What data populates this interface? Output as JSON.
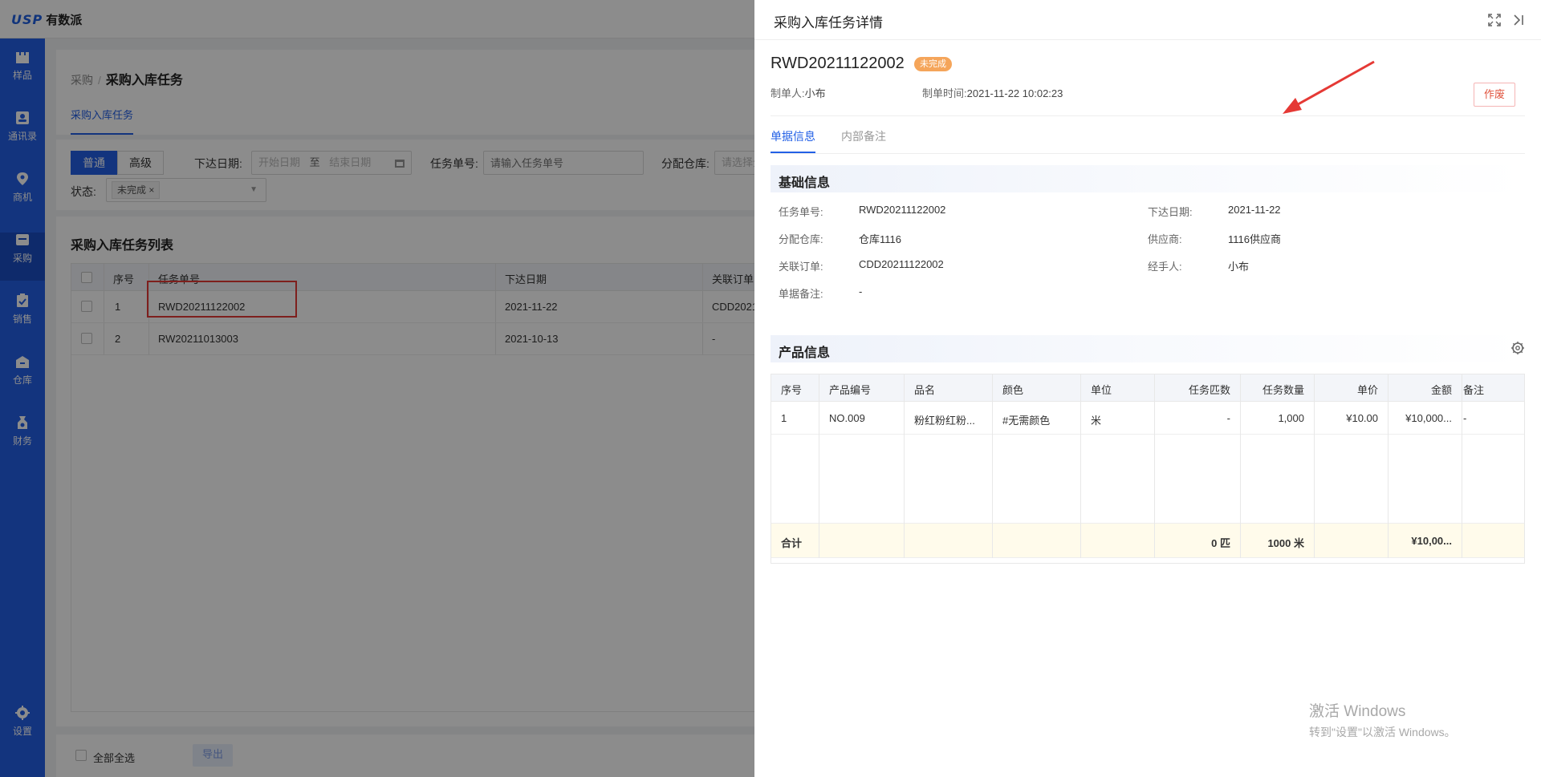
{
  "app": {
    "logo_mark": "USP",
    "logo_text": "有数派"
  },
  "sidebar": {
    "items": [
      {
        "label": "样品",
        "icon": "box-icon"
      },
      {
        "label": "通讯录",
        "icon": "contact-icon"
      },
      {
        "label": "商机",
        "icon": "location-icon"
      },
      {
        "label": "采购",
        "icon": "purchase-icon",
        "active": true
      },
      {
        "label": "销售",
        "icon": "clipboard-icon"
      },
      {
        "label": "仓库",
        "icon": "warehouse-icon"
      },
      {
        "label": "财务",
        "icon": "money-icon"
      },
      {
        "label": "设置",
        "icon": "gear-icon"
      }
    ]
  },
  "breadcrumb": {
    "parent": "采购",
    "sep": "/",
    "current": "采购入库任务"
  },
  "page_tab": "采购入库任务",
  "filter": {
    "mode_normal": "普通",
    "mode_advanced": "高级",
    "date_label": "下达日期:",
    "date_start": "开始日期",
    "date_to": "至",
    "date_end": "结束日期",
    "task_no_label": "任务单号:",
    "task_no_placeholder": "请输入任务单号",
    "warehouse_label": "分配仓库:",
    "warehouse_placeholder": "请选择分",
    "status_label": "状态:",
    "status_tag": "未完成"
  },
  "list": {
    "title": "采购入库任务列表",
    "columns": {
      "seq": "序号",
      "task_no": "任务单号",
      "date": "下达日期",
      "order": "关联订单"
    },
    "rows": [
      {
        "seq": "1",
        "task_no": "RWD20211122002",
        "date": "2021-11-22",
        "order": "CDD2021"
      },
      {
        "seq": "2",
        "task_no": "RW20211013003",
        "date": "2021-10-13",
        "order": "-"
      }
    ]
  },
  "footer": {
    "select_all": "全部全选",
    "export": "导出"
  },
  "drawer": {
    "title": "采购入库任务详情",
    "doc_no": "RWD20211122002",
    "status": "未完成",
    "creator_label": "制单人:",
    "creator": "小布",
    "created_label": "制单时间:",
    "created": "2021-11-22 10:02:23",
    "void_button": "作废",
    "tabs": [
      "单据信息",
      "内部备注"
    ],
    "basic": {
      "title": "基础信息",
      "fields": {
        "task_no": {
          "label": "任务单号:",
          "value": "RWD20211122002"
        },
        "issue_date": {
          "label": "下达日期:",
          "value": "2021-11-22"
        },
        "warehouse": {
          "label": "分配仓库:",
          "value": "仓库1116"
        },
        "supplier": {
          "label": "供应商:",
          "value": "1116供应商"
        },
        "order": {
          "label": "关联订单:",
          "value": "CDD20211122002"
        },
        "handler": {
          "label": "经手人:",
          "value": "小布"
        },
        "remark": {
          "label": "单据备注:",
          "value": "-"
        }
      }
    },
    "products": {
      "title": "产品信息",
      "columns": [
        "序号",
        "产品编号",
        "品名",
        "颜色",
        "单位",
        "任务匹数",
        "任务数量",
        "单价",
        "金额",
        "备注"
      ],
      "rows": [
        [
          "1",
          "NO.009",
          "粉红粉红粉...",
          "#无需颜色",
          "米",
          "-",
          "1,000",
          "¥10.00",
          "¥10,000...",
          "-"
        ]
      ],
      "total": {
        "label": "合计",
        "pieces": "0 匹",
        "qty": "1000 米",
        "amount": "¥10,00..."
      }
    }
  },
  "watermark": {
    "line1": "激活 Windows",
    "line2": "转到\"设置\"以激活 Windows。"
  },
  "colors": {
    "primary": "#2360e6",
    "badge": "#f5a55a",
    "danger": "#e53935"
  }
}
